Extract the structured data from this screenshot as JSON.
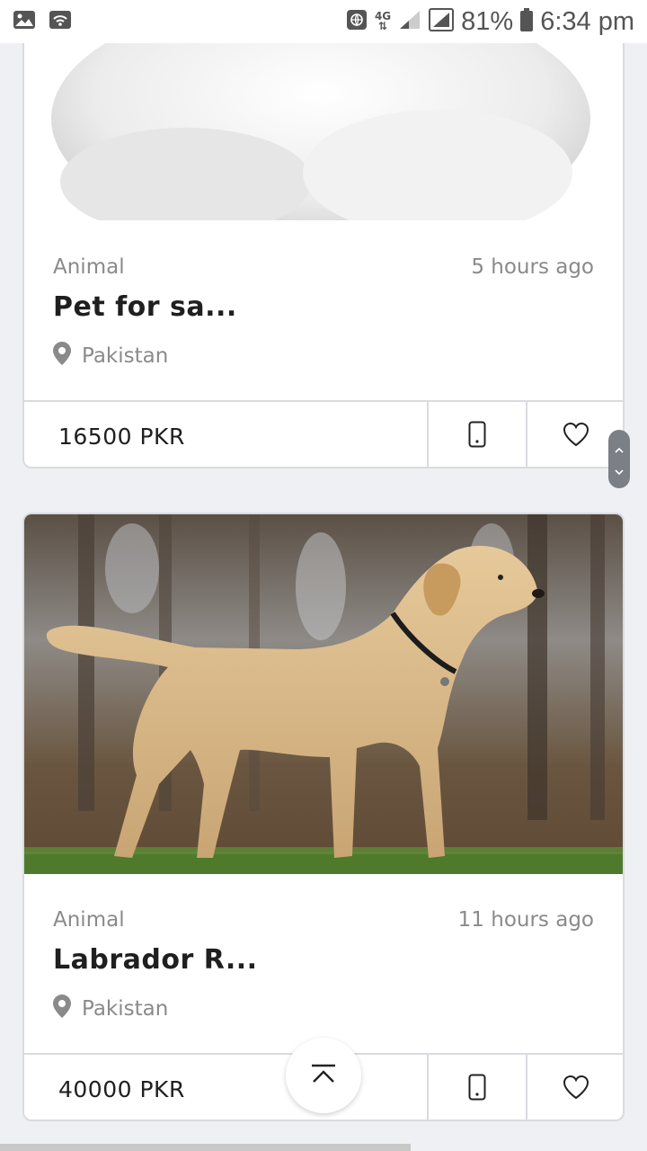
{
  "status_bar": {
    "network": "4G",
    "battery": "81%",
    "time": "6:34 pm"
  },
  "listings": [
    {
      "category": "Animal",
      "time_ago": "5 hours ago",
      "title": "Pet for sa...",
      "location": "Pakistan",
      "price": "16500 PKR"
    },
    {
      "category": "Animal",
      "time_ago": "11 hours ago",
      "title": "Labrador R...",
      "location": "Pakistan",
      "price": "40000 PKR"
    }
  ],
  "icons": {
    "location": "map-pin-icon",
    "phone": "phone-icon",
    "favorite": "heart-icon",
    "back_to_top": "chevron-up-icon"
  },
  "colors": {
    "page_bg": "#eef0f4",
    "card_border": "#d9dbe0",
    "muted_text": "#8a8a8a",
    "title_text": "#1f1f1f"
  }
}
